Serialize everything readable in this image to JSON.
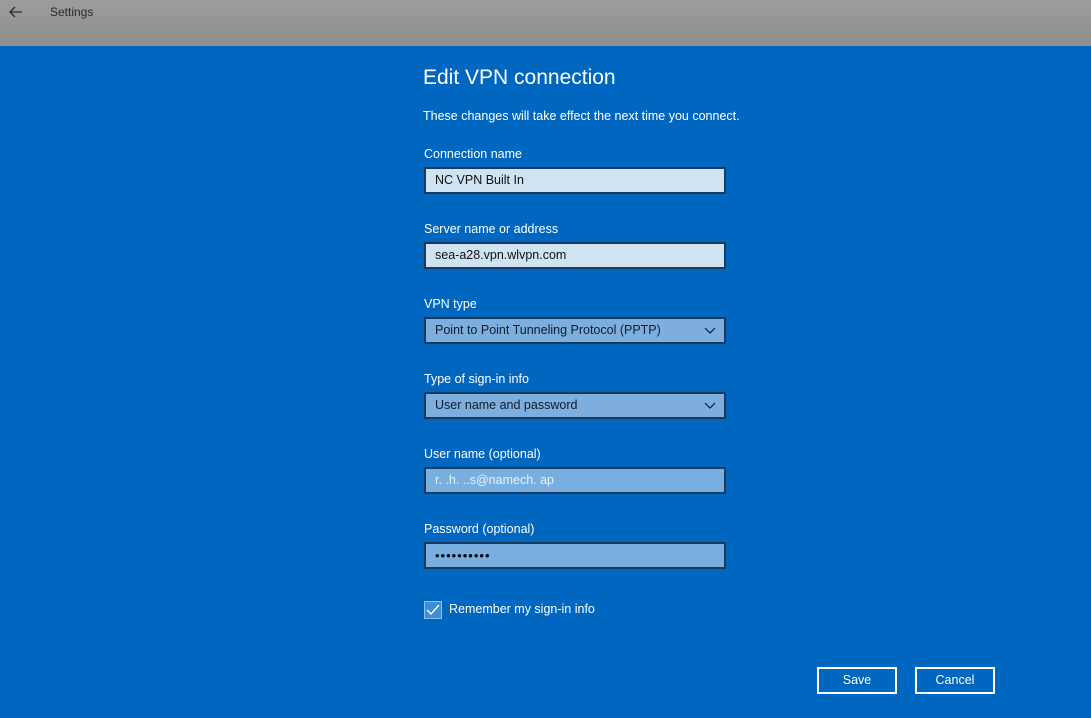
{
  "window": {
    "app_title": "Settings",
    "back_icon": "back-arrow-icon"
  },
  "dialog": {
    "title": "Edit VPN connection",
    "subtitle": "These changes will take effect the next time you connect.",
    "fields": {
      "connection_name": {
        "label": "Connection name",
        "value": "NC VPN Built In"
      },
      "server": {
        "label": "Server name or address",
        "value": "sea-a28.vpn.wlvpn.com"
      },
      "vpn_type": {
        "label": "VPN type",
        "value": "Point to Point Tunneling Protocol (PPTP)"
      },
      "signin_type": {
        "label": "Type of sign-in info",
        "value": "User name and password"
      },
      "username": {
        "label": "User name (optional)",
        "value": "r. .h. ..s@namech. ap"
      },
      "password": {
        "label": "Password (optional)",
        "value": "••••••••••"
      }
    },
    "remember": {
      "label": "Remember my sign-in info",
      "checked": true
    },
    "buttons": {
      "save": "Save",
      "cancel": "Cancel"
    }
  },
  "colors": {
    "dialog_bg": "#0067c0",
    "titlebar_bg": "#9a9a9a",
    "input_bg": "#cfe3f3",
    "dropdown_bg": "#7daede"
  }
}
